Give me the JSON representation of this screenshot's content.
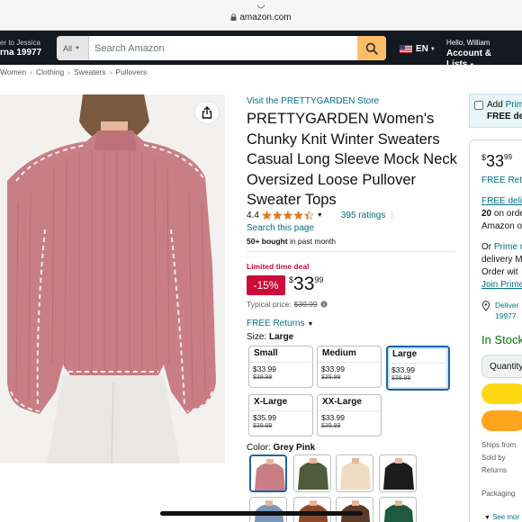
{
  "browser": {
    "share_glyph": "◡",
    "url": "amazon.com"
  },
  "header": {
    "deliver_line1": "er to Jessica",
    "deliver_line2": "rna 19977",
    "search_category": "All",
    "search_placeholder": "Search Amazon",
    "language": "EN",
    "greeting": "Hello, William",
    "account_label": "Account & Lists"
  },
  "breadcrumb": [
    "Women",
    "Clothing",
    "Sweaters",
    "Pullovers"
  ],
  "product": {
    "store_link": "Visit the PRETTYGARDEN Store",
    "title": "PRETTYGARDEN Women's Chunky Knit Winter Sweaters Casual Long Sleeve Mock Neck Oversized Loose Pullover Sweater Tops",
    "rating": "4.4",
    "rating_value": 4.4,
    "ratings_count": "395 ratings",
    "search_page": "Search this page",
    "bought_bold": "50+ bought",
    "bought_rest": "in past month",
    "deal_label": "Limited time deal",
    "discount": "-15%",
    "price_currency": "$",
    "price_whole": "33",
    "price_fraction": "99",
    "typical_label": "Typical price:",
    "typical_price": "$39.99",
    "free_returns": "FREE Returns",
    "size_label": "Size:",
    "size_selected": "Large",
    "sizes": [
      {
        "name": "Small",
        "price": "$33.99",
        "old": "$39.99"
      },
      {
        "name": "Medium",
        "price": "$33.99",
        "old": "$39.99"
      },
      {
        "name": "Large",
        "price": "$33.99",
        "old": "$39.99",
        "selected": true
      },
      {
        "name": "X-Large",
        "price": "$35.99",
        "old": "$39.99"
      },
      {
        "name": "XX-Large",
        "price": "$33.99",
        "old": "$39.99"
      }
    ],
    "color_label": "Color:",
    "color_selected": "Grey Pink",
    "swatch_colors": [
      "#c97d85",
      "#4f5b3c",
      "#efdcc0",
      "#1c1c1c",
      "#7c97b8",
      "#8a4a2b",
      "#5a3b2a",
      "#1f5a3e"
    ]
  },
  "buybox": {
    "prime_add": "Add",
    "prime_word": "Prim",
    "prime_free": "FREE del",
    "price_currency": "$",
    "price_whole": "33",
    "price_fraction": "99",
    "free_returns": "FREE Retu",
    "free_delivery": "FREE deliv",
    "date_bold": "20",
    "date_rest": "on orde",
    "amazon_line": "Amazon o",
    "or_text": "Or",
    "prime_link": "Prime m",
    "delivery_line": "delivery M",
    "order_line": "Order wit",
    "join_prime": "Join Prime",
    "deliver_to": "Deliver",
    "deliver_zip": "19977",
    "in_stock": "In Stock",
    "quantity": "Quantity",
    "ships_from": "Ships from",
    "sold_by": "Sold by",
    "returns": "Returns",
    "packaging": "Packaging",
    "see_more": "See mor"
  },
  "colors": {
    "header_bg": "#131921",
    "search_btn": "#febd69",
    "link": "#007185",
    "deal_red": "#cc0c39",
    "stock_green": "#007600",
    "add_to_cart": "#ffd814",
    "buy_now": "#ffa41c"
  }
}
